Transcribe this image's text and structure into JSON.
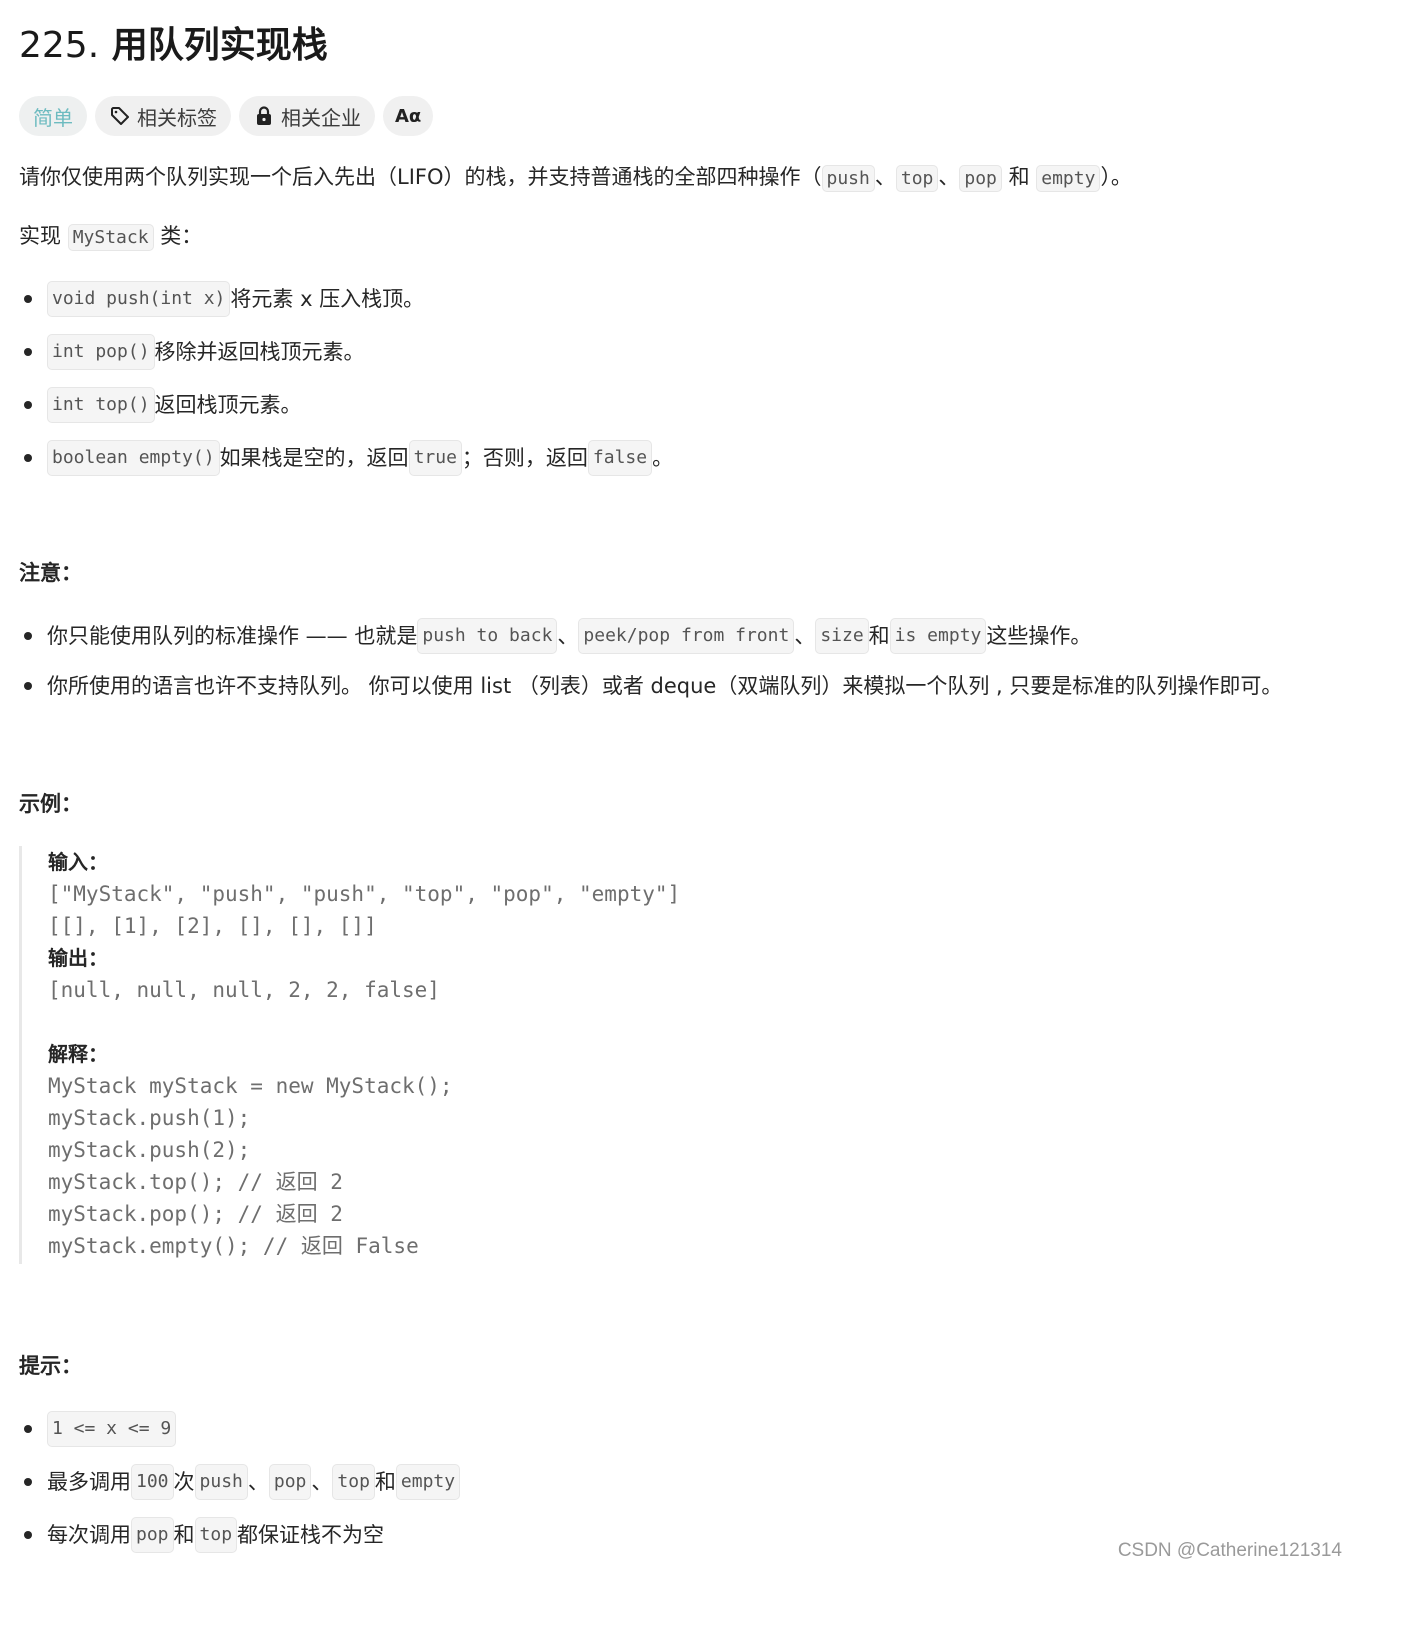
{
  "title": {
    "number": "225.",
    "name": "用队列实现栈"
  },
  "chips": {
    "difficulty": "简单",
    "tags": "相关标签",
    "companies": "相关企业",
    "language": "Aα"
  },
  "intro": {
    "text": "请你仅使用两个队列实现一个后入先出（LIFO）的栈，并支持普通栈的全部四种操作（",
    "ops": [
      "push",
      "top",
      "pop",
      "empty"
    ],
    "sep1": "、",
    "sep2": "、",
    "and": " 和 ",
    "end": "）。"
  },
  "implement": {
    "prefix": "实现 ",
    "class_name": "MyStack",
    "suffix": " 类："
  },
  "methods": [
    {
      "code": "void push(int x)",
      "desc": " 将元素 x 压入栈顶。"
    },
    {
      "code": "int pop()",
      "desc": " 移除并返回栈顶元素。"
    },
    {
      "code": "int top()",
      "desc": " 返回栈顶元素。"
    },
    {
      "code": "boolean empty()",
      "desc": " 如果栈是空的，返回 ",
      "code2": "true",
      "desc2": " ；否则，返回 ",
      "code3": "false",
      "desc3": " 。"
    }
  ],
  "notes": {
    "heading": "注意：",
    "item1": {
      "text": "你只能使用队列的标准操作 —— 也就是 ",
      "ops": [
        "push to back",
        "peek/pop from front",
        "size",
        "is empty"
      ],
      "sep": "、",
      "and": " 和 ",
      "end": " 这些操作。"
    },
    "item2": "你所使用的语言也许不支持队列。 你可以使用 list （列表）或者 deque（双端队列）来模拟一个队列 , 只要是标准的队列操作即可。"
  },
  "example": {
    "heading": "示例：",
    "input_label": "输入：",
    "input_line1": "[\"MyStack\", \"push\", \"push\", \"top\", \"pop\", \"empty\"]",
    "input_line2": "[[], [1], [2], [], [], []]",
    "output_label": "输出：",
    "output_line": "[null, null, null, 2, 2, false]",
    "explain_label": "解释：",
    "explain_lines": [
      "MyStack myStack = new MyStack();",
      "myStack.push(1);",
      "myStack.push(2);",
      "myStack.top(); // 返回 2",
      "myStack.pop(); // 返回 2",
      "myStack.empty(); // 返回 False"
    ]
  },
  "hints": {
    "heading": "提示：",
    "item1": "1 <= x <= 9",
    "item2": {
      "prefix": "最多调用",
      "count": "100",
      "mid": " 次 ",
      "ops": [
        "push",
        "pop",
        "top",
        "empty"
      ],
      "sep": "、",
      "and": " 和 "
    },
    "item3": {
      "prefix": "每次调用 ",
      "op1": "pop",
      "and": " 和 ",
      "op2": "top",
      "suffix": " 都保证栈不为空"
    }
  },
  "watermark": "CSDN @Catherine121314"
}
